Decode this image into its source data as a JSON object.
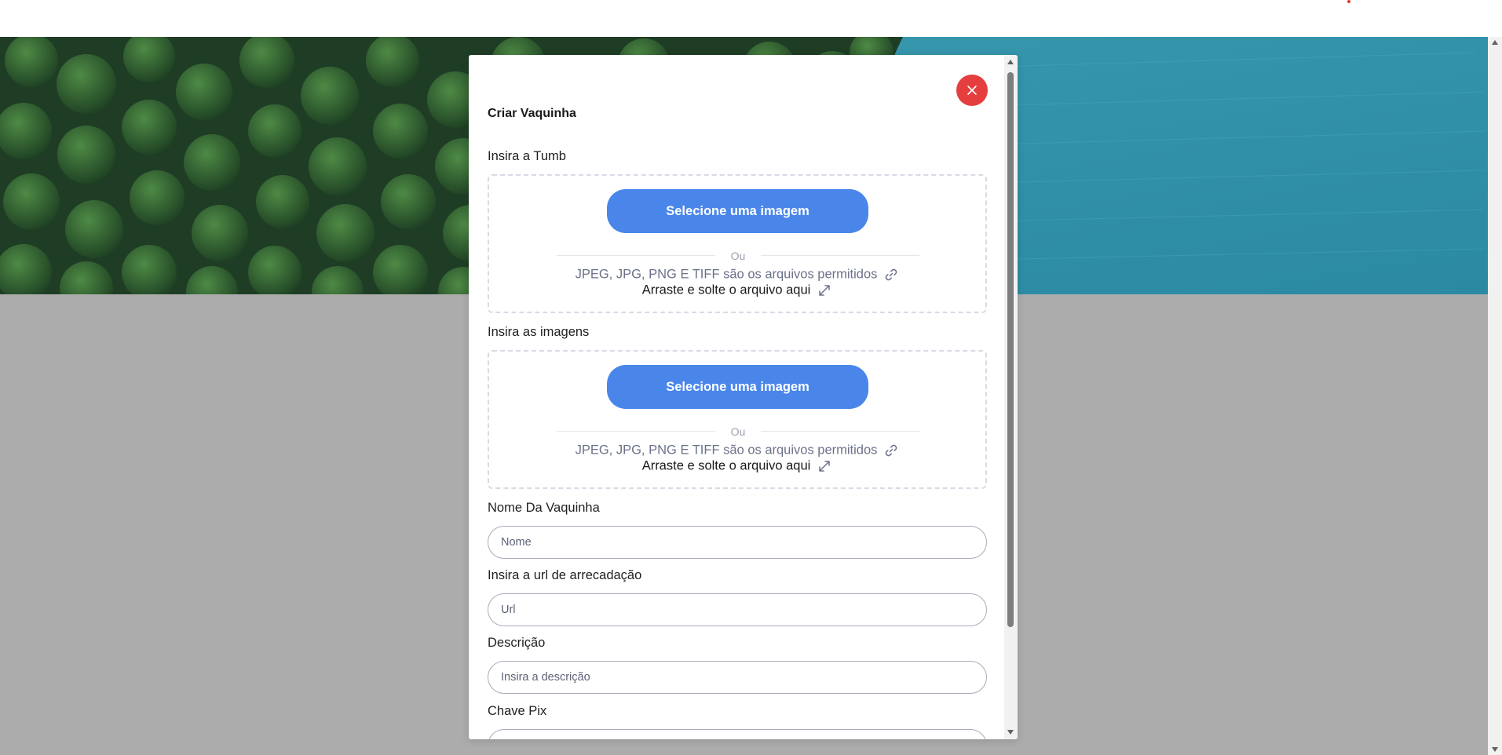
{
  "modal": {
    "title": "Criar Vaquinha",
    "close_icon": "close-icon",
    "thumb": {
      "label": "Insira a Tumb",
      "button": "Selecione uma imagem",
      "or": "Ou",
      "formats": "JPEG, JPG, PNG E TIFF são os arquivos permitidos",
      "drag_drop": "Arraste e solte o arquivo aqui"
    },
    "images": {
      "label": "Insira as imagens",
      "button": "Selecione uma imagem",
      "or": "Ou",
      "formats": "JPEG, JPG, PNG E TIFF são os arquivos permitidos",
      "drag_drop": "Arraste e solte o arquivo aqui"
    },
    "name_field": {
      "label": "Nome Da Vaquinha",
      "placeholder": "Nome",
      "value": ""
    },
    "url_field": {
      "label": "Insira a url de arrecadação",
      "placeholder": "Url",
      "value": ""
    },
    "description_field": {
      "label": "Descrição",
      "placeholder": "Insira a descrição",
      "value": ""
    },
    "pix_field": {
      "label": "Chave Pix"
    }
  },
  "colors": {
    "primary_button": "#4a86ea",
    "close_button": "#e53e3e",
    "overlay_gray": "#acacac"
  },
  "icons": [
    "close-icon",
    "link-icon",
    "expand-icon"
  ]
}
